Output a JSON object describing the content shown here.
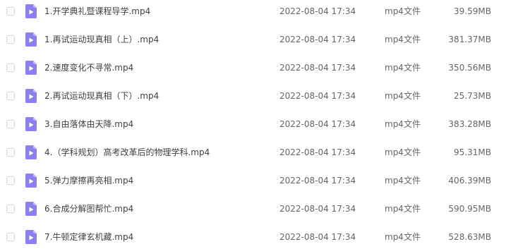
{
  "colors": {
    "icon_fill": "#8b80f0",
    "icon_fold": "#b9b2f7",
    "icon_play": "#ffffff"
  },
  "files": [
    {
      "name": "1.开学典礼暨课程导学.mp4",
      "date": "2022-08-04 17:34",
      "type": "mp4文件",
      "size": "39.59MB",
      "icon": "video-file-icon"
    },
    {
      "name": "1.再试运动现真相（上）.mp4",
      "date": "2022-08-04 17:34",
      "type": "mp4文件",
      "size": "381.37MB",
      "icon": "video-file-icon"
    },
    {
      "name": "2.速度变化不寻常.mp4",
      "date": "2022-08-04 17:34",
      "type": "mp4文件",
      "size": "350.56MB",
      "icon": "video-file-icon"
    },
    {
      "name": "2.再试运动现真相（下）.mp4",
      "date": "2022-08-04 17:34",
      "type": "mp4文件",
      "size": "25.73MB",
      "icon": "video-file-icon"
    },
    {
      "name": "3.自由落体由天降.mp4",
      "date": "2022-08-04 17:34",
      "type": "mp4文件",
      "size": "383.28MB",
      "icon": "video-file-icon"
    },
    {
      "name": "4.（学科规划）高考改革后的物理学科.mp4",
      "date": "2022-08-04 17:34",
      "type": "mp4文件",
      "size": "95.31MB",
      "icon": "video-file-icon"
    },
    {
      "name": "5.弹力摩擦再亮相.mp4",
      "date": "2022-08-04 17:34",
      "type": "mp4文件",
      "size": "406.39MB",
      "icon": "video-file-icon"
    },
    {
      "name": "6.合成分解图帮忙.mp4",
      "date": "2022-08-04 17:34",
      "type": "mp4文件",
      "size": "590.95MB",
      "icon": "video-file-icon"
    },
    {
      "name": "7.牛顿定律玄机藏.mp4",
      "date": "2022-08-04 17:34",
      "type": "mp4文件",
      "size": "528.63MB",
      "icon": "video-file-icon"
    }
  ]
}
